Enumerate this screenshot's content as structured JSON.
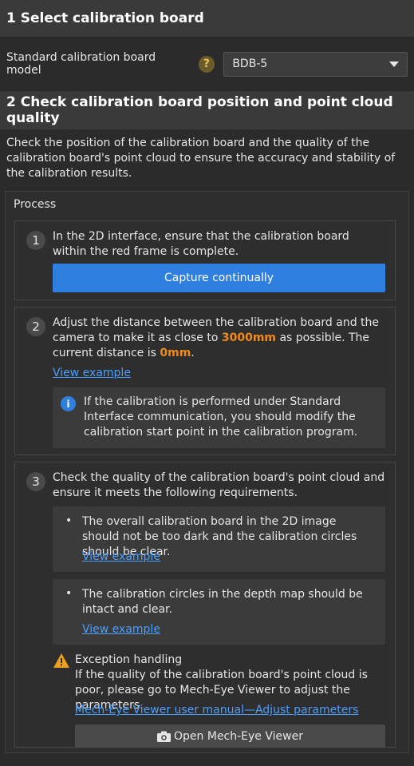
{
  "section1": {
    "title": "1 Select calibration board"
  },
  "model": {
    "label": "Standard calibration board model",
    "help": "?",
    "selected": "BDB-5"
  },
  "section2": {
    "title": "2 Check calibration board position and point cloud quality"
  },
  "intro": "Check the position of the calibration board and the quality of the calibration board's point cloud to ensure the accuracy and stability of the calibration results.",
  "process": {
    "title": "Process",
    "step1": {
      "number": "1",
      "text": "In the 2D interface, ensure that the calibration board within the red frame is complete.",
      "button": "Capture continually"
    },
    "step2": {
      "number": "2",
      "text_a": "Adjust the distance between the calibration board and the camera to make it as close to ",
      "distance_target": "3000mm",
      "text_b": " as possible. The current distance is ",
      "distance_current": "0mm",
      "text_c": ".",
      "link": "View example",
      "info_icon": "i",
      "info": "If the calibration is performed under Standard Interface communication, you should modify the calibration start point in the calibration program."
    },
    "step3": {
      "number": "3",
      "text": "Check the quality of the calibration board's point cloud and ensure it meets the following requirements.",
      "req1": {
        "text": "The overall calibration board in the 2D image should not be too dark and the calibration circles should be clear.",
        "link": "View example"
      },
      "req2": {
        "text": "The calibration circles in the depth map should be intact and clear.",
        "link": "View example"
      },
      "exception_title": "Exception handling",
      "exception_text": "If the quality of the calibration board's point cloud is poor, please go to Mech-Eye Viewer to adjust the parameters.",
      "manual_link": "Mech-Eye Viewer user manual—Adjust parameters",
      "open_button": "Open Mech-Eye Viewer"
    }
  },
  "colors": {
    "accent": "#2f7fe0",
    "highlight": "#f08a1c",
    "link": "#4a9fff",
    "warning": "#f0a020"
  },
  "icons": {
    "help": "question-icon",
    "dropdown": "chevron-down-icon",
    "info": "info-icon",
    "warning": "warning-icon",
    "camera": "camera-icon"
  }
}
